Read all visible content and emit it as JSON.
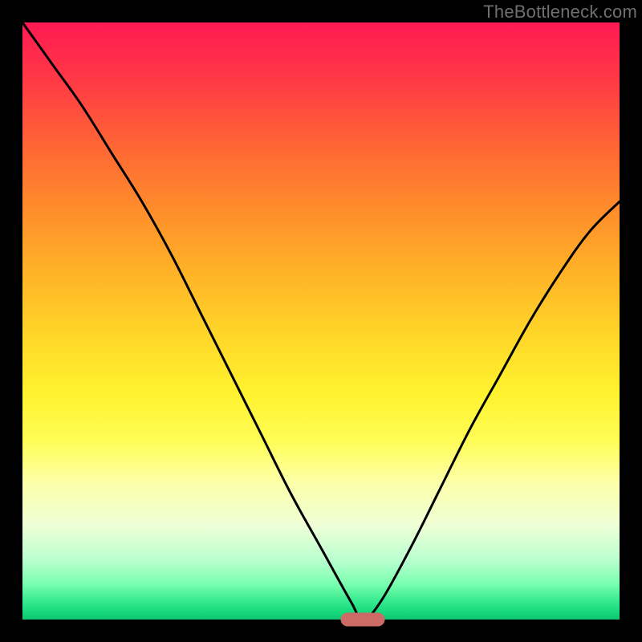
{
  "watermark": "TheBottleneck.com",
  "colors": {
    "page_bg": "#000000",
    "curve_stroke": "#000000",
    "watermark_text": "#6f6f6f",
    "marker": "#cc6a66",
    "gradient_top": "#ff1a53",
    "gradient_bottom": "#0fc46f"
  },
  "chart_data": {
    "type": "line",
    "title": "",
    "xlabel": "",
    "ylabel": "",
    "xlim": [
      0,
      100
    ],
    "ylim": [
      0,
      100
    ],
    "grid": false,
    "background": "vertical gradient from red (top, high bottleneck) to green (bottom, low bottleneck)",
    "series": [
      {
        "name": "bottleneck-curve",
        "description": "V-shaped bottleneck curve reaching ~0 at the optimal point",
        "x": [
          0,
          5,
          10,
          15,
          20,
          25,
          30,
          35,
          40,
          45,
          50,
          55,
          57,
          60,
          65,
          70,
          75,
          80,
          85,
          90,
          95,
          100
        ],
        "values": [
          100,
          93,
          86,
          78,
          70,
          61,
          51,
          41,
          31,
          21,
          12,
          3,
          0,
          3,
          12,
          22,
          32,
          41,
          50,
          58,
          65,
          70
        ]
      }
    ],
    "annotations": [
      {
        "name": "optimal-marker",
        "shape": "rounded-bar",
        "x": 57,
        "y": 0,
        "color": "#cc6a66"
      }
    ]
  }
}
